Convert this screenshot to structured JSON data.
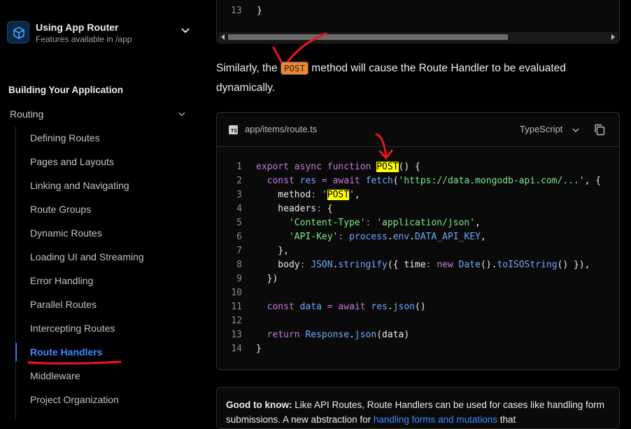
{
  "sidebar": {
    "router_title": "Using App Router",
    "router_subtitle": "Features available in /app",
    "section_title": "Building Your Application",
    "group_label": "Routing",
    "items": [
      {
        "label": "Defining Routes"
      },
      {
        "label": "Pages and Layouts"
      },
      {
        "label": "Linking and Navigating"
      },
      {
        "label": "Route Groups"
      },
      {
        "label": "Dynamic Routes"
      },
      {
        "label": "Loading UI and Streaming"
      },
      {
        "label": "Error Handling"
      },
      {
        "label": "Parallel Routes"
      },
      {
        "label": "Intercepting Routes"
      },
      {
        "label": "Route Handlers",
        "active": true
      },
      {
        "label": "Middleware"
      },
      {
        "label": "Project Organization"
      }
    ]
  },
  "top_code": {
    "line_number": "13",
    "text": "}"
  },
  "paragraph": {
    "before": "Similarly, the ",
    "code": "POST",
    "after": " method will cause the Route Handler to be evaluated dynamically."
  },
  "code_block": {
    "filename": "app/items/route.ts",
    "language": "TypeScript",
    "line_numbers": [
      "1",
      "2",
      "3",
      "4",
      "5",
      "6",
      "7",
      "8",
      "9",
      "10",
      "11",
      "12",
      "13",
      "14"
    ]
  },
  "note": {
    "bold": "Good to know:",
    "text": " Like API Routes, Route Handlers can be used for cases like handling form submissions. A new abstraction for ",
    "link": "handling forms and mutations",
    "tail": " that"
  },
  "colors": {
    "accent": "#3b8cff",
    "annotation_red": "#e8141b",
    "highlight": "#ffff00"
  }
}
